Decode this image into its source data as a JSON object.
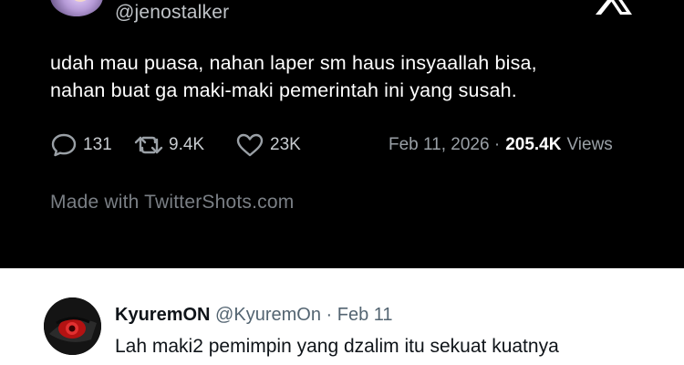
{
  "tweet": {
    "handle": "@jenostalker",
    "text_lines": [
      "udah mau puasa, nahan laper sm haus insyaallah bisa,",
      "nahan buat ga maki-maki pemerintah ini yang susah."
    ],
    "replies": "131",
    "retweets": "9.4K",
    "likes": "23K",
    "date": "Feb 11, 2026 ·",
    "views_count": "205.4K",
    "views_label": "Views",
    "footer": "Made with TwitterShots.com"
  },
  "reply": {
    "name": "KyuremON",
    "handle": "@KyuremOn",
    "separator": "·",
    "date": "Feb 11",
    "text": "Lah maki2 pemimpin yang dzalim itu sekuat kuatnya"
  },
  "icons": {
    "logo": "x-logo-icon",
    "reply": "comment-icon",
    "retweet": "retweet-icon",
    "like": "heart-icon"
  },
  "colors": {
    "card_bg": "#000000",
    "text": "#ffffff",
    "muted": "#9aa0a6",
    "reply_bg": "#ffffff",
    "reply_muted": "#536471",
    "avatar_eye": "#d11a1a"
  }
}
